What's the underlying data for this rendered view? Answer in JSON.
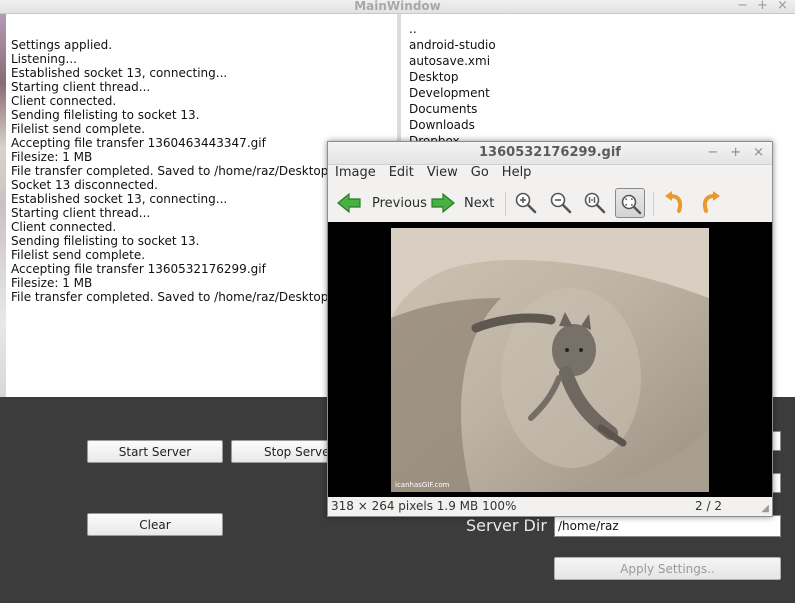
{
  "main_window": {
    "title": "MainWindow",
    "log_lines": [
      "Settings applied.",
      "Listening...",
      "Established socket 13, connecting...",
      "Starting client thread...",
      "Client connected.",
      "Sending filelisting to socket 13.",
      "Filelist send complete.",
      "Accepting file transfer 1360463443347.gif",
      "Filesize: 1 MB",
      "File transfer completed. Saved to /home/raz/Desktop",
      "Socket 13 disconnected.",
      "Established socket 13, connecting...",
      "Starting client thread...",
      "Client connected.",
      "Sending filelisting to socket 13.",
      "Filelist send complete.",
      "Accepting file transfer 1360532176299.gif",
      "Filesize: 1 MB",
      "File transfer completed. Saved to /home/raz/Desktop"
    ],
    "file_list": [
      "..",
      "android-studio",
      "autosave.xmi",
      "Desktop",
      "Development",
      "Documents",
      "Downloads",
      "Dropbox"
    ],
    "buttons": {
      "start": "Start Server",
      "stop": "Stop Server",
      "clear": "Clear",
      "apply": "Apply Settings.."
    },
    "server_dir": {
      "label": "Server Dir",
      "value": "/home/raz"
    },
    "window_controls": {
      "minimize": "−",
      "maximize": "+",
      "close": "×"
    }
  },
  "image_viewer": {
    "title": "1360532176299.gif",
    "menus": [
      "Image",
      "Edit",
      "View",
      "Go",
      "Help"
    ],
    "toolbar": {
      "previous": "Previous",
      "next": "Next"
    },
    "image_watermark": "icanhasGIF.com",
    "status": {
      "info": "318 × 264 pixels  1.9 MB    100%",
      "position": "2 / 2"
    },
    "window_controls": {
      "minimize": "−",
      "maximize": "+",
      "close": "×"
    }
  },
  "colors": {
    "bottom_panel": "#3c3c3c",
    "arrow_green": "#3fa33a",
    "rotate_orange": "#f0a030"
  }
}
